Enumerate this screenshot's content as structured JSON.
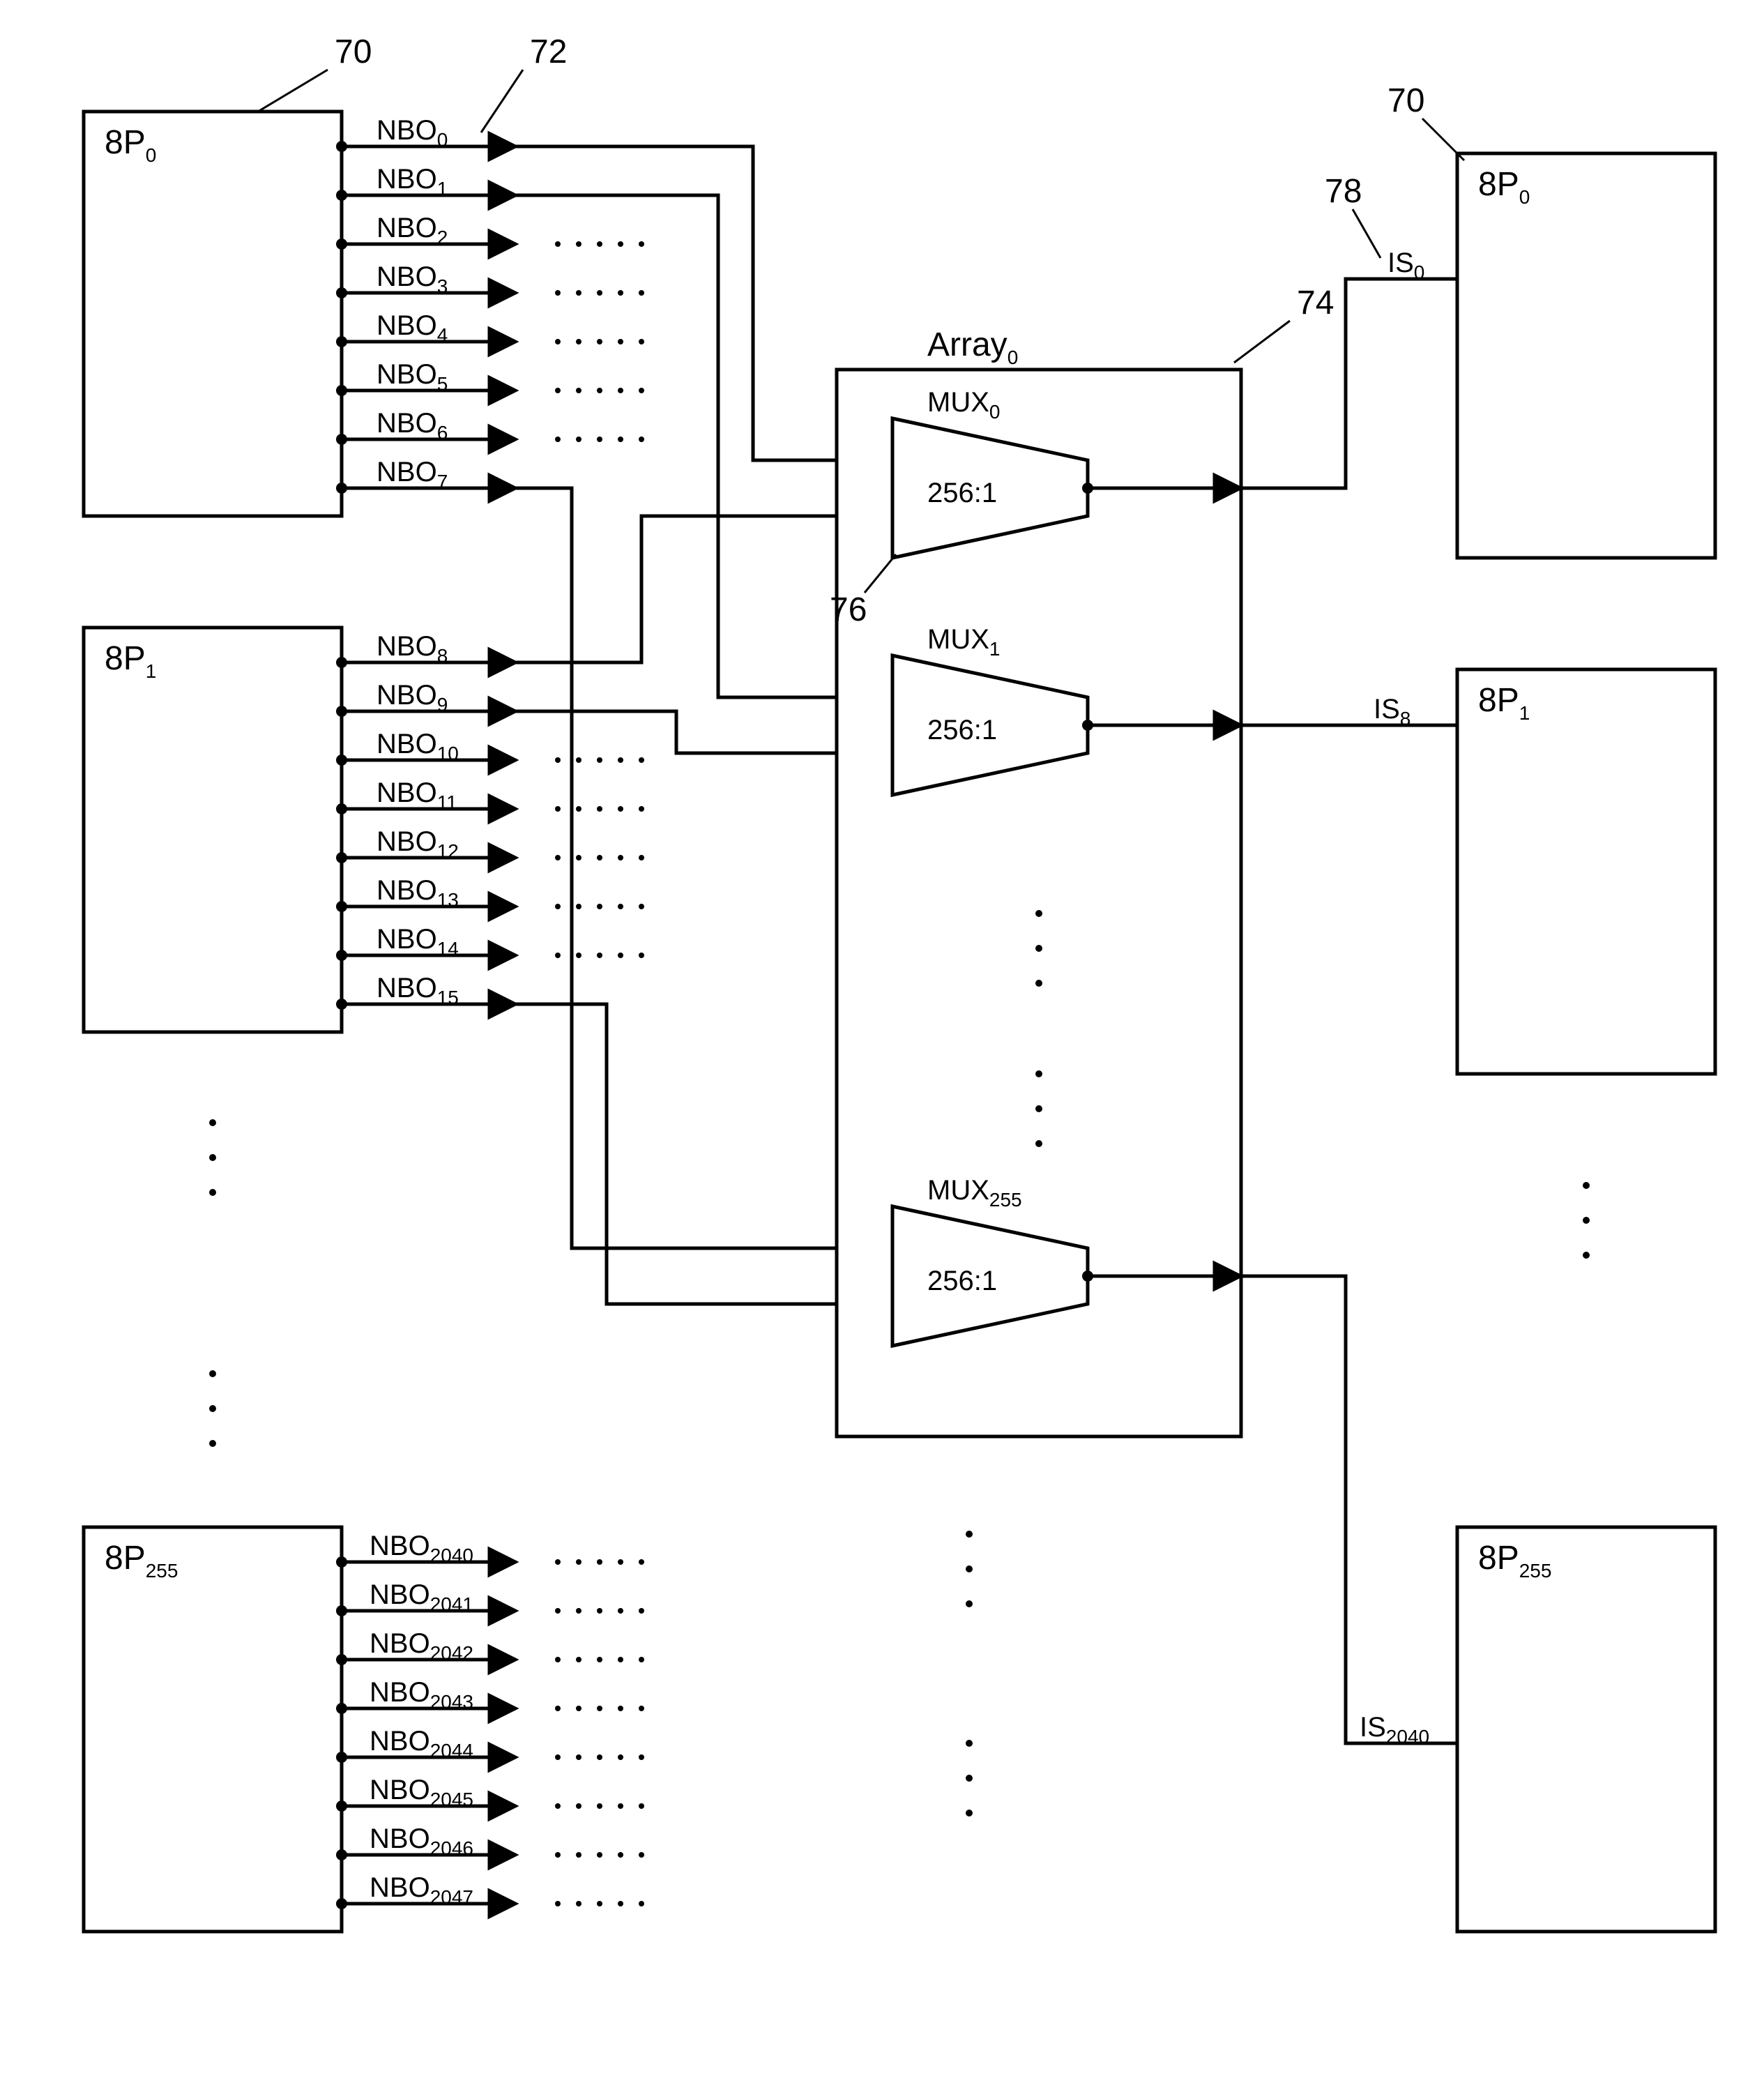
{
  "refs": {
    "r70a": "70",
    "r70b": "70",
    "r72": "72",
    "r74": "74",
    "r76": "76",
    "r78": "78"
  },
  "left_blocks": [
    {
      "label": "8P",
      "sub": "0",
      "outputs": [
        {
          "label": "NBO",
          "sub": "0"
        },
        {
          "label": "NBO",
          "sub": "1"
        },
        {
          "label": "NBO",
          "sub": "2"
        },
        {
          "label": "NBO",
          "sub": "3"
        },
        {
          "label": "NBO",
          "sub": "4"
        },
        {
          "label": "NBO",
          "sub": "5"
        },
        {
          "label": "NBO",
          "sub": "6"
        },
        {
          "label": "NBO",
          "sub": "7"
        }
      ]
    },
    {
      "label": "8P",
      "sub": "1",
      "outputs": [
        {
          "label": "NBO",
          "sub": "8"
        },
        {
          "label": "NBO",
          "sub": "9"
        },
        {
          "label": "NBO",
          "sub": "10"
        },
        {
          "label": "NBO",
          "sub": "11"
        },
        {
          "label": "NBO",
          "sub": "12"
        },
        {
          "label": "NBO",
          "sub": "13"
        },
        {
          "label": "NBO",
          "sub": "14"
        },
        {
          "label": "NBO",
          "sub": "15"
        }
      ]
    },
    {
      "label": "8P",
      "sub": "255",
      "outputs": [
        {
          "label": "NBO",
          "sub": "2040"
        },
        {
          "label": "NBO",
          "sub": "2041"
        },
        {
          "label": "NBO",
          "sub": "2042"
        },
        {
          "label": "NBO",
          "sub": "2043"
        },
        {
          "label": "NBO",
          "sub": "2044"
        },
        {
          "label": "NBO",
          "sub": "2045"
        },
        {
          "label": "NBO",
          "sub": "2046"
        },
        {
          "label": "NBO",
          "sub": "2047"
        }
      ]
    }
  ],
  "array": {
    "label": "Array",
    "sub": "0",
    "muxes": [
      {
        "label": "MUX",
        "sub": "0",
        "ratio": "256:1"
      },
      {
        "label": "MUX",
        "sub": "1",
        "ratio": "256:1"
      },
      {
        "label": "MUX",
        "sub": "255",
        "ratio": "256:1"
      }
    ]
  },
  "right_blocks": [
    {
      "label": "8P",
      "sub": "0",
      "in": {
        "label": "IS",
        "sub": "0"
      }
    },
    {
      "label": "8P",
      "sub": "1",
      "in": {
        "label": "IS",
        "sub": "8"
      }
    },
    {
      "label": "8P",
      "sub": "255",
      "in": {
        "label": "IS",
        "sub": "2040"
      }
    }
  ]
}
